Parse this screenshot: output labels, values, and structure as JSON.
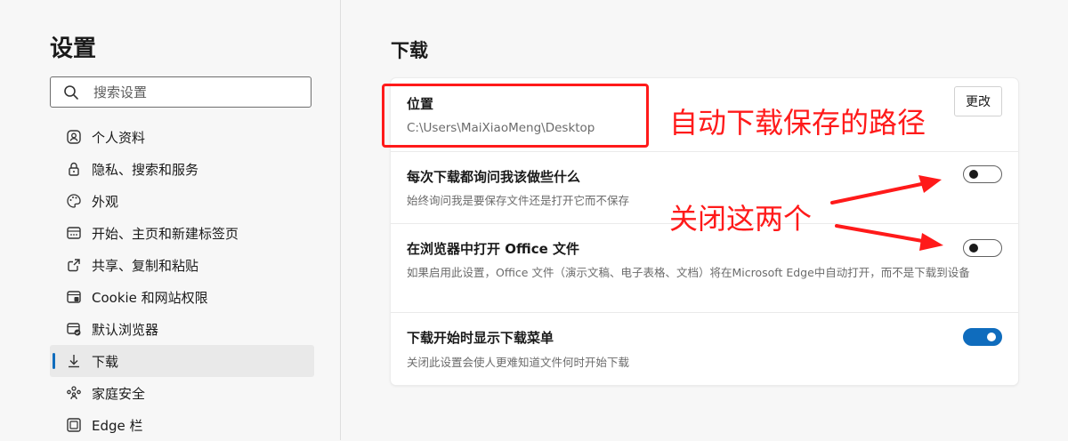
{
  "sidebar": {
    "title": "设置",
    "search": {
      "placeholder": "搜索设置",
      "icon": "search-icon"
    },
    "items": [
      {
        "label": "个人资料",
        "icon": "profile-icon"
      },
      {
        "label": "隐私、搜索和服务",
        "icon": "lock-icon"
      },
      {
        "label": "外观",
        "icon": "palette-icon"
      },
      {
        "label": "开始、主页和新建标签页",
        "icon": "home-grid-icon"
      },
      {
        "label": "共享、复制和粘贴",
        "icon": "share-icon"
      },
      {
        "label": "Cookie 和网站权限",
        "icon": "site-permissions-icon"
      },
      {
        "label": "默认浏览器",
        "icon": "default-browser-icon"
      },
      {
        "label": "下载",
        "icon": "download-icon",
        "active": true
      },
      {
        "label": "家庭安全",
        "icon": "family-icon"
      },
      {
        "label": "Edge 栏",
        "icon": "edge-bar-icon"
      }
    ]
  },
  "main": {
    "title": "下载",
    "location": {
      "title": "位置",
      "path": "C:\\Users\\MaiXiaoMeng\\Desktop",
      "change_label": "更改"
    },
    "rows": [
      {
        "title": "每次下载都询问我该做些什么",
        "desc": "始终询问我是要保存文件还是打开它而不保存",
        "enabled": false
      },
      {
        "title": "在浏览器中打开 Office 文件",
        "desc": "如果启用此设置，Office 文件（演示文稿、电子表格、文档）将在Microsoft Edge中自动打开，而不是下载到设备",
        "enabled": false
      },
      {
        "title": "下载开始时显示下载菜单",
        "desc": "关闭此设置会使人更难知道文件何时开始下载",
        "enabled": true
      }
    ]
  },
  "annotations": {
    "path_note": "自动下载保存的路径",
    "close_note": "关闭这两个",
    "color": "#ff1a1a"
  },
  "colors": {
    "accent": "#0f6cbd"
  }
}
